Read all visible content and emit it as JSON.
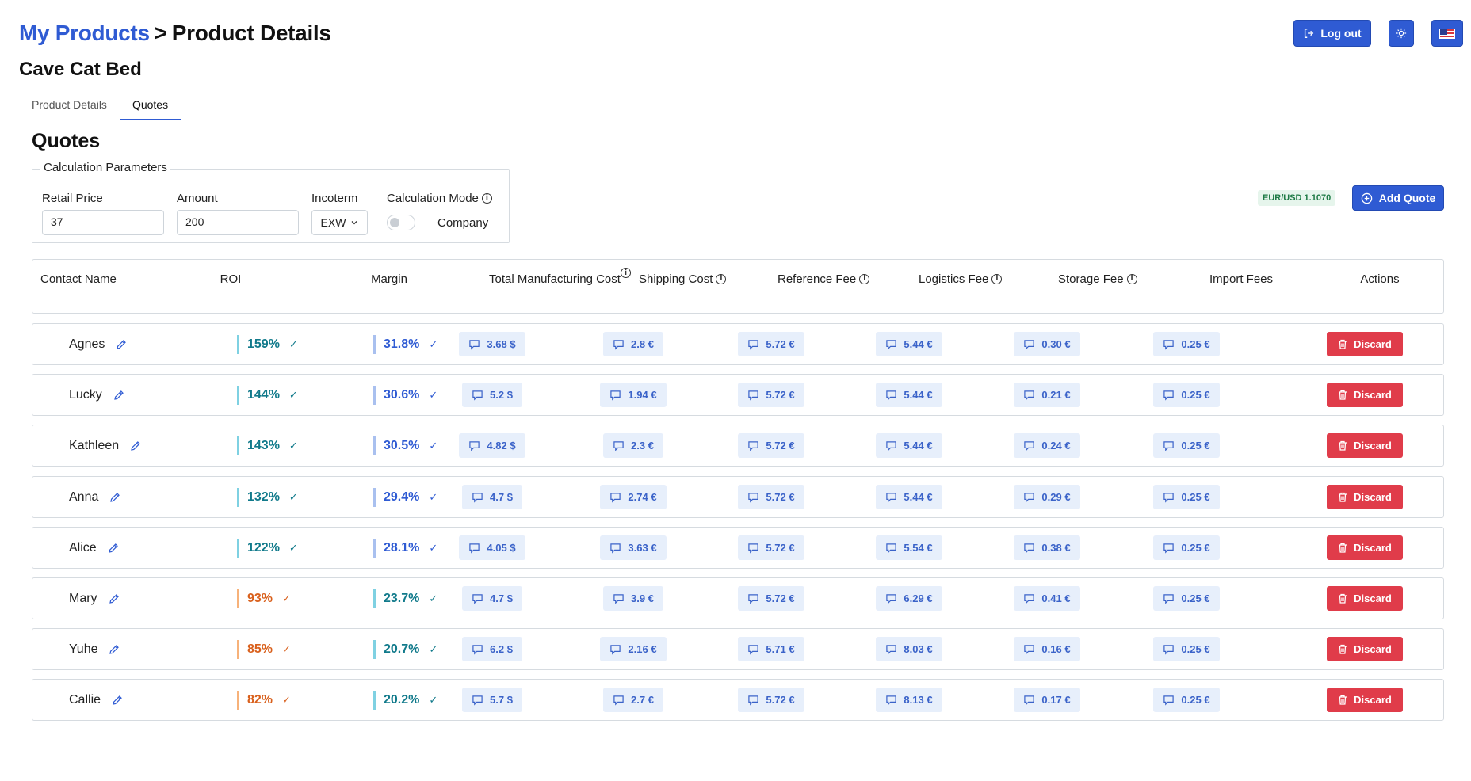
{
  "header": {
    "breadcrumb_link": "My Products",
    "breadcrumb_sep": ">",
    "breadcrumb_current": "Product Details",
    "logout_label": "Log out"
  },
  "product": {
    "name": "Cave Cat Bed"
  },
  "tabs": [
    {
      "label": "Product Details",
      "active": false
    },
    {
      "label": "Quotes",
      "active": true
    }
  ],
  "section_title": "Quotes",
  "params": {
    "legend": "Calculation Parameters",
    "retail_price_label": "Retail Price",
    "retail_price_value": "37",
    "amount_label": "Amount",
    "amount_value": "200",
    "incoterm_label": "Incoterm",
    "incoterm_value": "EXW",
    "calc_mode_label": "Calculation Mode",
    "calc_mode_value": "Company"
  },
  "rate_badge": "EUR/USD 1.1070",
  "add_quote_label": "Add Quote",
  "columns": {
    "contact": "Contact Name",
    "roi": "ROI",
    "margin": "Margin",
    "total_manufacturing": "Total Manufacturing Cost",
    "shipping": "Shipping Cost",
    "reference": "Reference Fee",
    "logistics": "Logistics Fee",
    "storage": "Storage Fee",
    "import": "Import Fees",
    "actions": "Actions"
  },
  "discard_label": "Discard",
  "quotes": [
    {
      "name": "Agnes",
      "roi": "159%",
      "roi_color": "teal",
      "margin": "31.8%",
      "margin_color": "blue",
      "total": "3.68 $",
      "shipping": "2.8 €",
      "reference": "5.72 €",
      "logistics": "5.44 €",
      "storage": "0.30 €",
      "import": "0.25 €"
    },
    {
      "name": "Lucky",
      "roi": "144%",
      "roi_color": "teal",
      "margin": "30.6%",
      "margin_color": "blue",
      "total": "5.2 $",
      "shipping": "1.94 €",
      "reference": "5.72 €",
      "logistics": "5.44 €",
      "storage": "0.21 €",
      "import": "0.25 €"
    },
    {
      "name": "Kathleen",
      "roi": "143%",
      "roi_color": "teal",
      "margin": "30.5%",
      "margin_color": "blue",
      "total": "4.82 $",
      "shipping": "2.3 €",
      "reference": "5.72 €",
      "logistics": "5.44 €",
      "storage": "0.24 €",
      "import": "0.25 €"
    },
    {
      "name": "Anna",
      "roi": "132%",
      "roi_color": "teal",
      "margin": "29.4%",
      "margin_color": "blue",
      "total": "4.7 $",
      "shipping": "2.74 €",
      "reference": "5.72 €",
      "logistics": "5.44 €",
      "storage": "0.29 €",
      "import": "0.25 €"
    },
    {
      "name": "Alice",
      "roi": "122%",
      "roi_color": "teal",
      "margin": "28.1%",
      "margin_color": "blue",
      "total": "4.05 $",
      "shipping": "3.63 €",
      "reference": "5.72 €",
      "logistics": "5.54 €",
      "storage": "0.38 €",
      "import": "0.25 €"
    },
    {
      "name": "Mary",
      "roi": "93%",
      "roi_color": "orange",
      "margin": "23.7%",
      "margin_color": "teal",
      "total": "4.7 $",
      "shipping": "3.9 €",
      "reference": "5.72 €",
      "logistics": "6.29 €",
      "storage": "0.41 €",
      "import": "0.25 €"
    },
    {
      "name": "Yuhe",
      "roi": "85%",
      "roi_color": "orange",
      "margin": "20.7%",
      "margin_color": "teal",
      "total": "6.2 $",
      "shipping": "2.16 €",
      "reference": "5.71 €",
      "logistics": "8.03 €",
      "storage": "0.16 €",
      "import": "0.25 €"
    },
    {
      "name": "Callie",
      "roi": "82%",
      "roi_color": "orange",
      "margin": "20.2%",
      "margin_color": "teal",
      "total": "5.7 $",
      "shipping": "2.7 €",
      "reference": "5.72 €",
      "logistics": "8.13 €",
      "storage": "0.17 €",
      "import": "0.25 €"
    }
  ],
  "colors": {
    "primary": "#2f5bd3",
    "danger": "#e03c4a",
    "teal": "#117a8b",
    "orange": "#d9601c",
    "pill_bg": "#e7effb"
  }
}
